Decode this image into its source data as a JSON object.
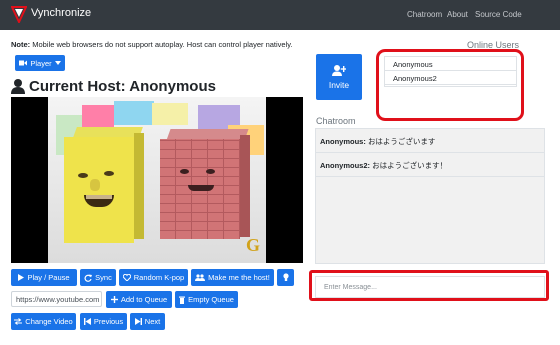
{
  "nav": {
    "brand": "Vynchronize",
    "links": [
      "Chatroom",
      "About",
      "Source Code"
    ]
  },
  "note": {
    "label": "Note:",
    "text": "Mobile web browsers do not support autoplay. Host can control player natively."
  },
  "player_dropdown": {
    "label": "Player",
    "icon": "video-camera-icon"
  },
  "host": {
    "title": "Current Host: Anonymous",
    "icon": "user-icon"
  },
  "video": {
    "characters": [
      "yellow-face-box",
      "brick-face-box"
    ],
    "watermark": "G"
  },
  "controls": {
    "play_pause": "Play / Pause",
    "sync": "Sync",
    "random": "Random K-pop",
    "make_host": "Make me the host!",
    "tip_icon": "lightbulb-icon",
    "url_value": "https://www.youtube.com",
    "add_queue": "Add to Queue",
    "empty_queue": "Empty Queue",
    "change_video": "Change Video",
    "previous": "Previous",
    "next": "Next"
  },
  "invite": {
    "label": "Invite",
    "icon": "user-plus-icon"
  },
  "online": {
    "title": "Online Users",
    "users": [
      "Anonymous",
      "Anonymous2"
    ]
  },
  "chat": {
    "title": "Chatroom",
    "messages": [
      {
        "user": "Anonymous:",
        "text": "おはようございます"
      },
      {
        "user": "Anonymous2:",
        "text": "おはようございます！"
      }
    ],
    "placeholder": "Enter Message..."
  },
  "colors": {
    "navbar": "#343a40",
    "primary": "#1a73e8",
    "highlight": "#e0101a"
  }
}
